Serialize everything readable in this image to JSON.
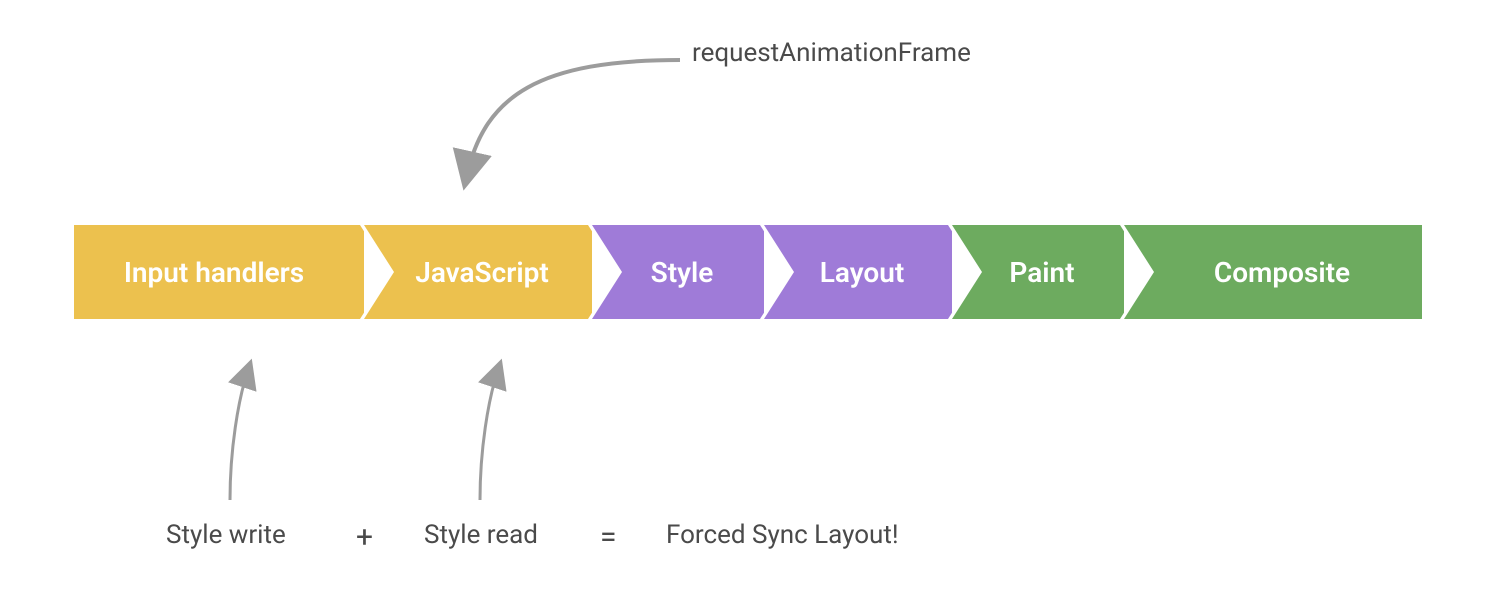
{
  "top_label": "requestAnimationFrame",
  "stages": [
    {
      "label": "Input handlers",
      "color": "#ecc14e"
    },
    {
      "label": "JavaScript",
      "color": "#ecc14e"
    },
    {
      "label": "Style",
      "color": "#9f7bd8"
    },
    {
      "label": "Layout",
      "color": "#9f7bd8"
    },
    {
      "label": "Paint",
      "color": "#6dab5f"
    },
    {
      "label": "Composite",
      "color": "#6dab5f"
    }
  ],
  "bottom": {
    "style_write": "Style write",
    "plus": "+",
    "style_read": "Style read",
    "equals": "=",
    "result": "Forced Sync Layout!"
  }
}
